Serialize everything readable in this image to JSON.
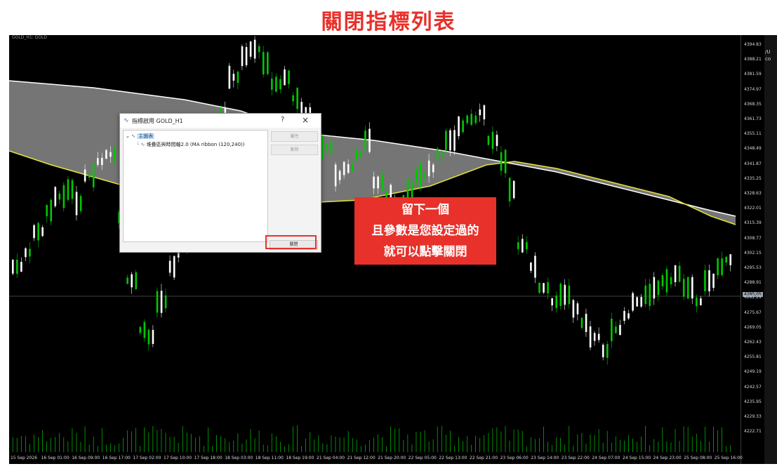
{
  "page": {
    "title": "關閉指標列表"
  },
  "chart": {
    "header": "GOLD_H1: GOLD",
    "right_panel_text": [
      "/U",
      "co"
    ],
    "price_labels": [
      "4394.83",
      "4388.21",
      "4381.59",
      "4374.97",
      "4368.35",
      "4361.73",
      "4355.11",
      "4348.49",
      "4341.87",
      "4335.25",
      "4328.63",
      "4322.01",
      "4315.39",
      "4308.77",
      "4302.15",
      "4295.53",
      "4288.91",
      "4282.29",
      "4275.67",
      "4269.05",
      "4262.43",
      "4255.81",
      "4249.19",
      "4242.57",
      "4235.95",
      "4229.33",
      "4222.71"
    ],
    "current_price": "4285.05",
    "time_labels": [
      "15 Sep 2026",
      "16 Sep 01:00",
      "16 Sep 09:00",
      "16 Sep 17:00",
      "17 Sep 02:00",
      "17 Sep 10:00",
      "17 Sep 18:00",
      "18 Sep 03:00",
      "18 Sep 11:00",
      "18 Sep 19:00",
      "21 Sep 04:00",
      "21 Sep 12:00",
      "21 Sep 20:00",
      "22 Sep 05:00",
      "22 Sep 13:00",
      "22 Sep 21:00",
      "23 Sep 06:00",
      "23 Sep 14:00",
      "23 Sep 22:00",
      "24 Sep 07:00",
      "24 Sep 15:00",
      "24 Sep 23:00",
      "25 Sep 08:00",
      "25 Sep 16:00"
    ],
    "colors": {
      "bull": "#ffffff",
      "bear": "#00c800",
      "ribbon": "#8a8a8a",
      "fast_ma": "#e8e23a",
      "slow_ma": "#ffffff"
    }
  },
  "dialog": {
    "title": "指標啟用 GOLD_H1",
    "help_label": "?",
    "close_icon": "×",
    "tree": {
      "root_label": "主圖表",
      "child_label": "堆疊區與時間軸2.0 (MA ribbon (120,240))"
    },
    "buttons": {
      "properties": "屬性",
      "delete": "刪除",
      "close": "關閉"
    }
  },
  "callout": {
    "lines": [
      "留下一個",
      "且參數是您設定過的",
      "就可以點擊關閉"
    ]
  }
}
